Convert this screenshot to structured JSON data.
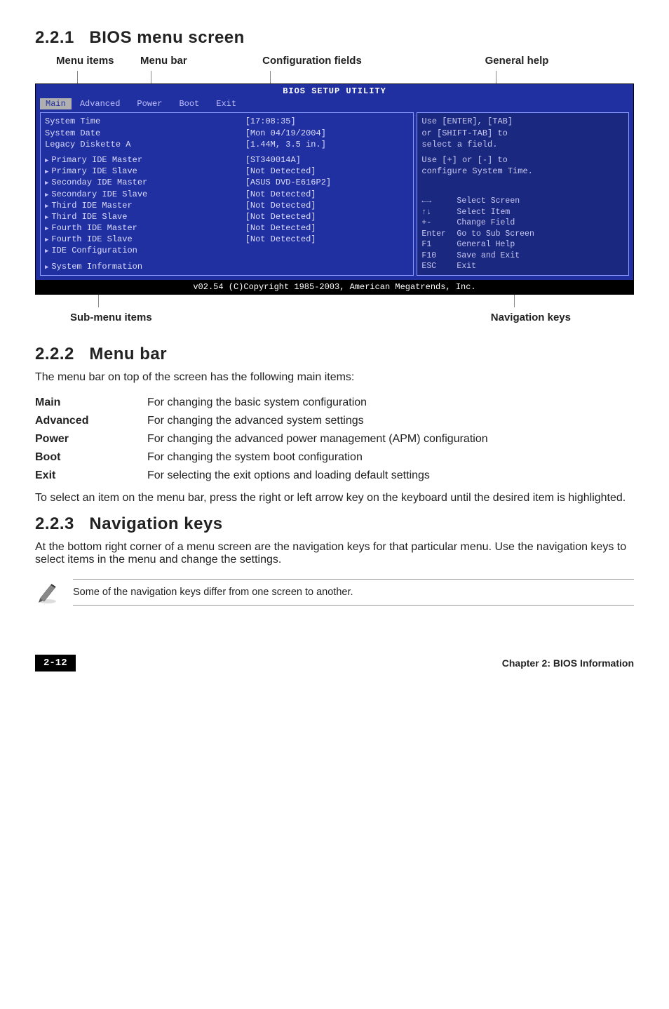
{
  "sections": {
    "s1": {
      "num": "2.2.1",
      "title": "BIOS menu screen"
    },
    "s2": {
      "num": "2.2.2",
      "title": "Menu bar"
    },
    "s3": {
      "num": "2.2.3",
      "title": "Navigation keys"
    }
  },
  "labels": {
    "menu_items": "Menu items",
    "menu_bar": "Menu bar",
    "conf_fields": "Configuration fields",
    "general_help": "General help",
    "sub_menu": "Sub-menu items",
    "nav_keys": "Navigation keys"
  },
  "bios": {
    "title": "BIOS SETUP UTILITY",
    "menus": {
      "main": "Main",
      "advanced": "Advanced",
      "power": "Power",
      "boot": "Boot",
      "exit": "Exit"
    },
    "top_rows": [
      {
        "k": "System Time",
        "v": "[17:08:35]"
      },
      {
        "k": "System Date",
        "v": "[Mon 04/19/2004]"
      },
      {
        "k": "Legacy Diskette A",
        "v": "[1.44M, 3.5 in.]"
      }
    ],
    "list_rows": [
      {
        "k": "Primary IDE Master",
        "v": "[ST340014A]"
      },
      {
        "k": "Primary IDE Slave",
        "v": "[Not Detected]"
      },
      {
        "k": "Seconday IDE Master",
        "v": "[ASUS DVD-E616P2]"
      },
      {
        "k": "Secondary IDE Slave",
        "v": "[Not Detected]"
      },
      {
        "k": "Third IDE Master",
        "v": "[Not Detected]"
      },
      {
        "k": "Third IDE Slave",
        "v": "[Not Detected]"
      },
      {
        "k": "Fourth IDE Master",
        "v": "[Not Detected]"
      },
      {
        "k": "Fourth IDE Slave",
        "v": "[Not Detected]"
      },
      {
        "k": "IDE Configuration",
        "v": ""
      }
    ],
    "sysinfo": "System Information",
    "help_top": {
      "l1": "Use [ENTER], [TAB]",
      "l2": "or [SHIFT-TAB] to",
      "l3": "select a field.",
      "l4": "Use [+] or [-] to",
      "l5": "configure System Time."
    },
    "help_keys": [
      {
        "k": "←→",
        "v": "Select Screen"
      },
      {
        "k": "↑↓",
        "v": "Select Item"
      },
      {
        "k": "+-",
        "v": "Change Field"
      },
      {
        "k": "Enter",
        "v": "Go to Sub Screen"
      },
      {
        "k": "F1",
        "v": "General Help"
      },
      {
        "k": "F10",
        "v": "Save and Exit"
      },
      {
        "k": "ESC",
        "v": "Exit"
      }
    ],
    "footer": "v02.54 (C)Copyright 1985-2003, American Megatrends, Inc."
  },
  "menubar_intro": "The menu bar on top of the screen has the following main items:",
  "defs": {
    "main": {
      "k": "Main",
      "v": "For changing the basic system configuration"
    },
    "advanced": {
      "k": "Advanced",
      "v": "For changing the advanced system settings"
    },
    "power": {
      "k": "Power",
      "v": "For changing the advanced power management (APM) configuration"
    },
    "boot": {
      "k": "Boot",
      "v": "For changing the system boot configuration"
    },
    "exit": {
      "k": "Exit",
      "v": "For selecting the exit options and loading default settings"
    }
  },
  "menubar_outro": "To select an item on the menu bar, press the right or left arrow key on the keyboard until the desired item is highlighted.",
  "nav_body": "At the bottom right corner of a menu screen are the navigation keys for that particular menu. Use the navigation keys to select items in the menu and change the settings.",
  "note": "Some of the navigation keys differ from one screen to another.",
  "footer": {
    "page": "2-12",
    "chapter": "Chapter 2: BIOS Information"
  }
}
